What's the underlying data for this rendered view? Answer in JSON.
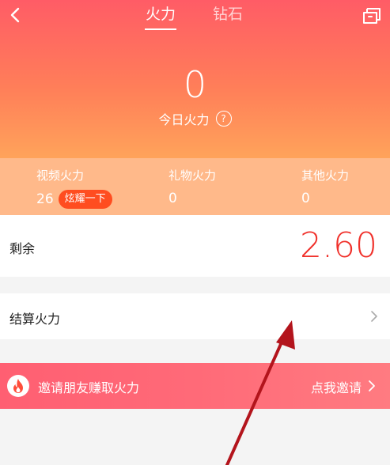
{
  "tabs": [
    {
      "label": "火力",
      "active": true
    },
    {
      "label": "钻石",
      "active": false
    }
  ],
  "today": {
    "value": "0",
    "label": "今日火力"
  },
  "stats": [
    {
      "label": "视频火力",
      "value": "26",
      "action": "炫耀一下"
    },
    {
      "label": "礼物火力",
      "value": "0"
    },
    {
      "label": "其他火力",
      "value": "0"
    }
  ],
  "remain": {
    "label": "剩余",
    "value": "2.60"
  },
  "settle": {
    "label": "结算火力"
  },
  "invite": {
    "text": "邀请朋友赚取火力",
    "action": "点我邀请"
  },
  "icons": [
    "back-icon",
    "share-icon",
    "help-icon",
    "chevron-right-icon",
    "fire-icon"
  ],
  "colors": {
    "header_top": "#ff5c66",
    "header_bottom": "#ffa35a",
    "stats_bg": "#ffb98a",
    "accent_red": "#f0312b",
    "badge": "#ff4d20",
    "invite_bg": "#ff6a78",
    "annotation_arrow": "#b3141c"
  }
}
